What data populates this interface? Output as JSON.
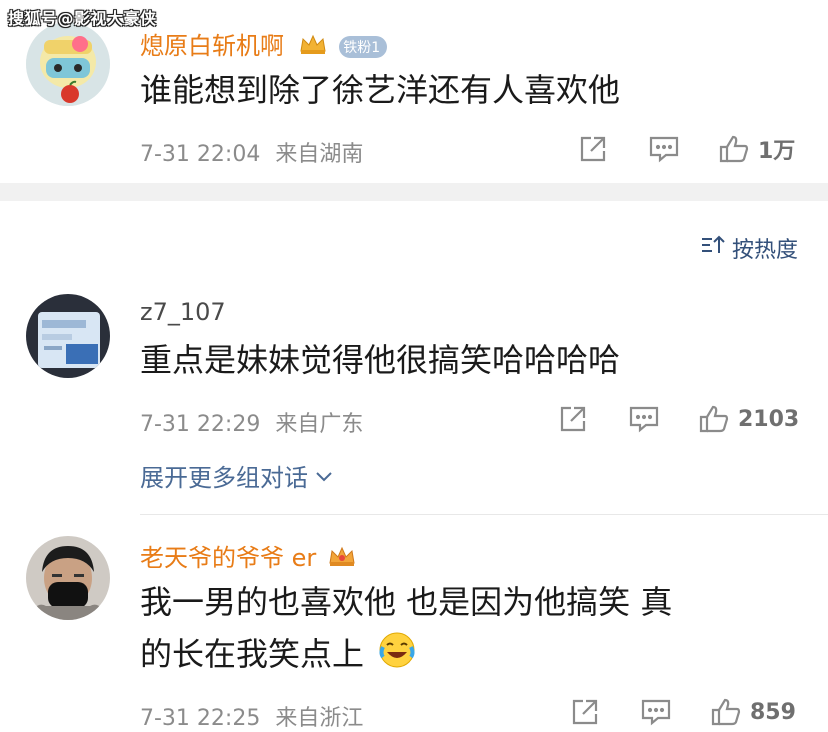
{
  "watermark": "搜狐号@影视大豪侠",
  "top_comment": {
    "username": "熄原白斩机啊",
    "fan_badge": "铁粉1",
    "text": "谁能想到除了徐艺洋还有人喜欢他",
    "time": "7-31 22:04",
    "location": "来自湖南",
    "likes": "1万"
  },
  "sort_label": "按热度",
  "replies": [
    {
      "username": "z7_107",
      "text": "重点是妹妹觉得他很搞笑哈哈哈哈",
      "time": "7-31 22:29",
      "location": "来自广东",
      "likes": "2103"
    },
    {
      "username": "老天爷的爷爷 er",
      "text_line1": "我一男的也喜欢他 也是因为他搞笑 真",
      "text_line2": "的长在我笑点上",
      "time": "7-31 22:25",
      "location": "来自浙江",
      "likes": "859"
    }
  ],
  "expand_label": "展开更多组对话",
  "colors": {
    "username_orange": "#e87c17",
    "meta_gray": "#8b8b8b",
    "link_blue": "#4a6a95"
  },
  "icons": [
    "share-icon",
    "comment-icon",
    "like-icon",
    "crown-icon",
    "laugh-cry-emoji",
    "sort-icon",
    "chevron-down-icon"
  ]
}
